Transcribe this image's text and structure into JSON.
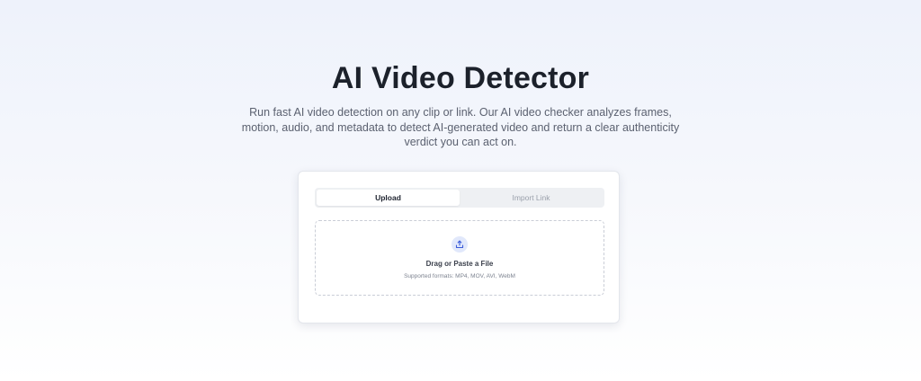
{
  "hero": {
    "title": "AI Video Detector",
    "subtitle": "Run fast AI video detection on any clip or link. Our AI video checker analyzes frames, motion, audio, and metadata to detect AI-generated video and return a clear authenticity verdict you can act on."
  },
  "uploader": {
    "tabs": [
      {
        "label": "Upload",
        "active": true
      },
      {
        "label": "Import Link",
        "active": false
      }
    ],
    "dropzone": {
      "icon": "upload-icon",
      "title": "Drag or Paste a File",
      "formats": "Supported formats: MP4, MOV, AVI, WebM"
    }
  },
  "colors": {
    "accent_icon_bg": "#e1e8fb",
    "accent_icon": "#3a5bd9",
    "title": "#1c212b"
  }
}
